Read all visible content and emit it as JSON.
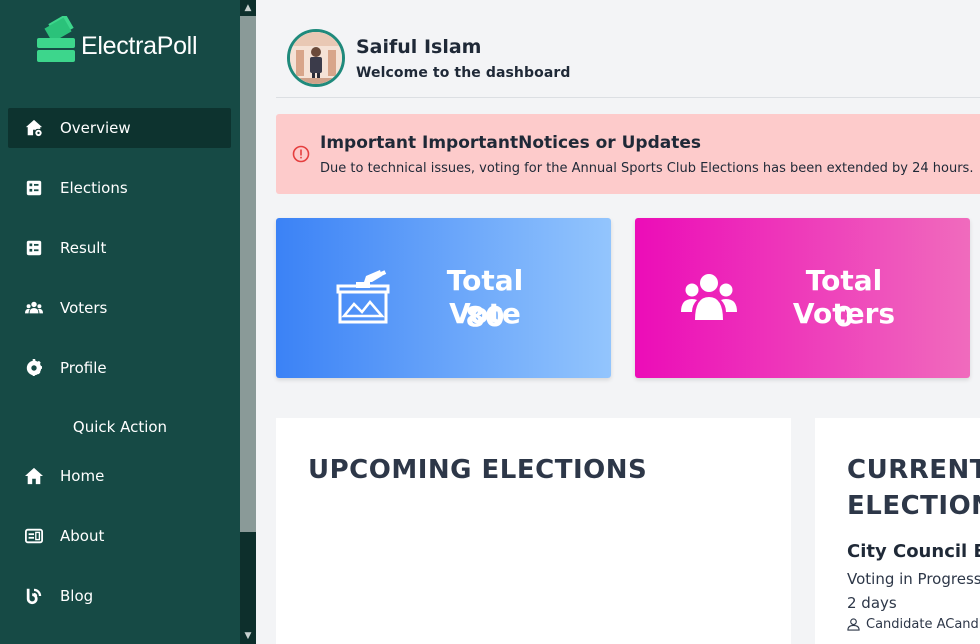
{
  "brand": {
    "name": "ElectraPoll",
    "logo_icon": "ballot-box-icon",
    "accent": "#3dd68c"
  },
  "sidebar": {
    "items": [
      {
        "label": "Overview",
        "icon": "home-settings-icon",
        "active": true
      },
      {
        "label": "Elections",
        "icon": "list-icon",
        "active": false
      },
      {
        "label": "Result",
        "icon": "list-icon",
        "active": false
      },
      {
        "label": "Voters",
        "icon": "users-icon",
        "active": false
      },
      {
        "label": "Profile",
        "icon": "gear-icon",
        "active": false
      }
    ],
    "quick_action_title": "Quick Action",
    "quick_items": [
      {
        "label": "Home",
        "icon": "home-icon"
      },
      {
        "label": "About",
        "icon": "id-card-icon"
      },
      {
        "label": "Blog",
        "icon": "blog-icon"
      }
    ]
  },
  "header": {
    "user_name": "Saiful Islam",
    "subtitle": "Welcome to the dashboard"
  },
  "notice": {
    "title": "Important ImportantNotices or Updates",
    "body": "Due to technical issues, voting for the Annual Sports Club Elections has been extended by 24 hours."
  },
  "stats": {
    "total_vote": {
      "label": "Total Vote",
      "value": "80"
    },
    "total_voters": {
      "label": "Total Voters",
      "value": "0"
    }
  },
  "upcoming": {
    "title": "UPCOMING ELECTIONS"
  },
  "current": {
    "title_line1": "CURRENT",
    "title_line2": "ELECTION",
    "election_name": "City Council El",
    "status": "Voting in Progress",
    "days": "2 days",
    "candidate": "Candidate ACandi"
  },
  "colors": {
    "sidebar_bg": "#164a45",
    "sidebar_active": "#0d332f",
    "notice_bg": "#fdcbcb",
    "vote_card_start": "#3b82f6",
    "voters_card_start": "#ec0cb8"
  }
}
